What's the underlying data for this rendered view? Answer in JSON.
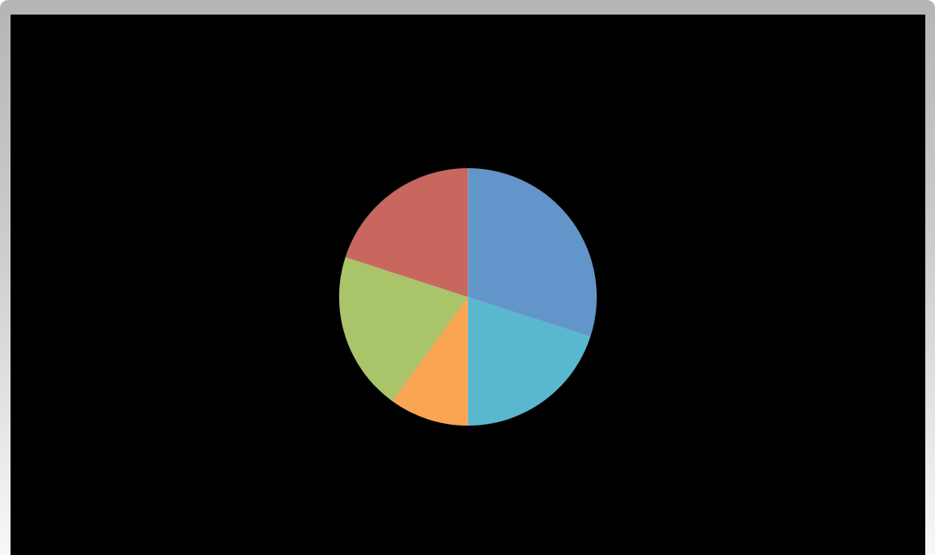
{
  "window": {
    "frame_color": "#bdbdbd",
    "background_color": "#000000"
  },
  "chart_data": {
    "type": "pie",
    "title": "",
    "start_angle_deg": 0,
    "direction": "clockwise",
    "legend": "none",
    "data_labels": false,
    "slices": [
      {
        "value": 30,
        "color": "#6295CA"
      },
      {
        "value": 20,
        "color": "#59B7D0"
      },
      {
        "value": 10,
        "color": "#F9A552"
      },
      {
        "value": 20,
        "color": "#AAC46A"
      },
      {
        "value": 20,
        "color": "#C9675E"
      }
    ]
  }
}
